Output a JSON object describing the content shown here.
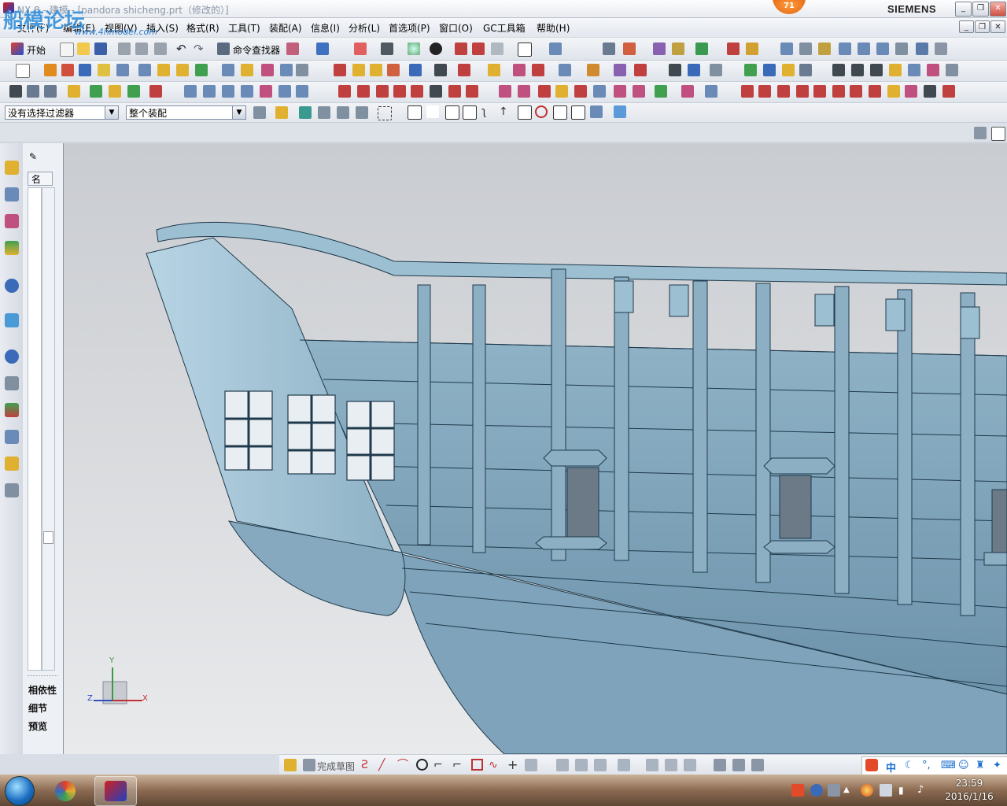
{
  "window": {
    "title": "NX 8 - 建模 - [pandora shicheng.prt（修改的）]",
    "notification_count": "71",
    "brand": "SIEMENS"
  },
  "watermark": {
    "text": "船模论坛",
    "url": "www.4hmodel.com"
  },
  "menu": [
    "文件(F)",
    "编辑(E)",
    "视图(V)",
    "插入(S)",
    "格式(R)",
    "工具(T)",
    "装配(A)",
    "信息(I)",
    "分析(L)",
    "首选项(P)",
    "窗口(O)",
    "GC工具箱",
    "帮助(H)"
  ],
  "toolbar": {
    "start_label": "开始",
    "command_finder_label": "命令查找器"
  },
  "selection": {
    "filter_value": "没有选择过滤器",
    "scope_value": "整个装配"
  },
  "nav_panel": {
    "column_header": "名",
    "sections": [
      "相依性",
      "细节",
      "预览"
    ]
  },
  "sketch_bar": {
    "finish_label": "完成草图"
  },
  "ime": {
    "mode": "中"
  },
  "taskbar": {
    "time": "23:59",
    "date": "2016/1/16"
  },
  "colors": {
    "model": "#8fb2c6",
    "model_edge": "#1f3a4c",
    "viewport_top": "#c9ccd1",
    "viewport_bottom": "#e9eaec"
  },
  "triad": {
    "x": "X",
    "y": "Y",
    "z": "Z"
  }
}
